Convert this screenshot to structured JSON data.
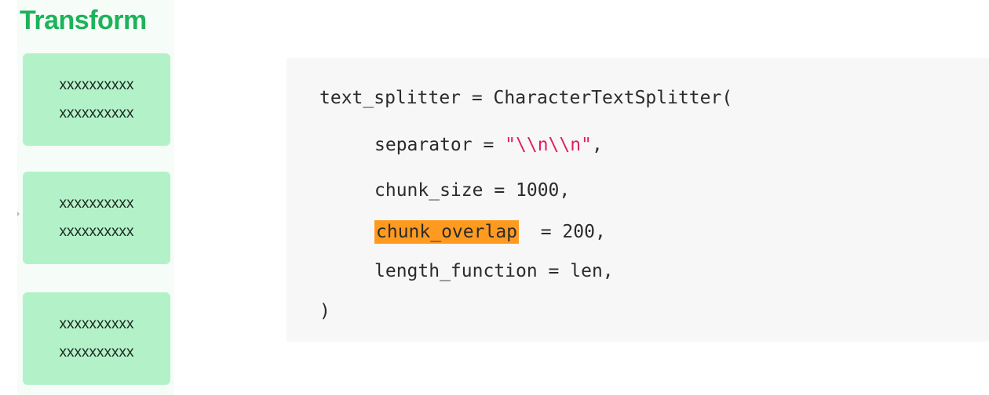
{
  "left_panel": {
    "title": "Transform",
    "chunks": [
      {
        "line1": "xxxxxxxxxx",
        "line2": "xxxxxxxxxx"
      },
      {
        "line1": "xxxxxxxxxx",
        "line2": "xxxxxxxxxx"
      },
      {
        "line1": "xxxxxxxxxx",
        "line2": "xxxxxxxxxx"
      }
    ]
  },
  "code": {
    "line1": "text_splitter = CharacterTextSplitter(",
    "separator_name": "separator = ",
    "separator_value": "\"\\\\n\\\\n\"",
    "separator_suffix": ",",
    "chunk_size": "chunk_size = 1000,",
    "chunk_overlap_name": "chunk_overlap",
    "chunk_overlap_rest": "  = 200,",
    "length_function": "length_function = len,",
    "close": ")"
  },
  "colors": {
    "title": "#1db35a",
    "chunk_bg": "#b3f2c9",
    "code_bg": "#f7f7f7",
    "string": "#e0215a",
    "highlight": "#ff9a21"
  }
}
